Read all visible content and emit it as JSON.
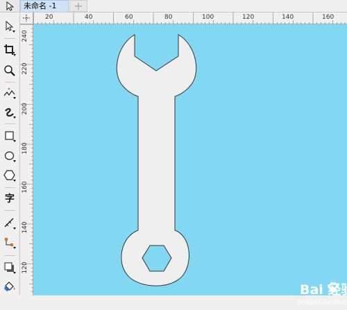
{
  "tabs": {
    "active_label": "未命名 -1",
    "add_symbol": "+"
  },
  "toolbox": {
    "tools": [
      "pick-tool",
      "shape-tool",
      "crop-tool",
      "zoom-tool",
      "freehand-tool",
      "artistic-media-tool",
      "rectangle-tool",
      "ellipse-tool",
      "polygon-tool",
      "text-tool",
      "dimension-tool",
      "connector-tool",
      "drop-shadow-tool",
      "fill-tool"
    ],
    "text_tool_glyph": "字"
  },
  "ruler": {
    "horizontal_labels": [
      "20",
      "40",
      "60",
      "80",
      "100",
      "120",
      "140",
      "160"
    ],
    "vertical_labels": [
      "240",
      "220",
      "200",
      "180",
      "160",
      "140",
      "120"
    ]
  },
  "canvas": {
    "background": "#82d8f2",
    "shape": "wrench",
    "shape_fill": "#efefef",
    "shape_stroke": "#333333"
  },
  "watermark": {
    "brand": "Bai 经验",
    "url": "jingyan.baidu.com"
  }
}
